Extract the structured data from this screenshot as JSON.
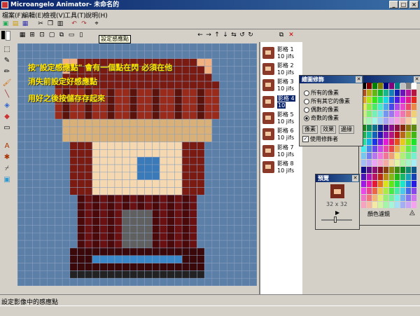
{
  "window": {
    "title": "Microangelo Animator- 未命名的"
  },
  "menu": [
    "檔案(F)",
    "編輯(E)",
    "檢視(V)",
    "工具(T)",
    "說明(H)"
  ],
  "tooltip": "設定感應點",
  "overlay": {
    "line1": "按\"設定感應點\"  會有一個點在閃  必須在他",
    "line2": "消失前設定好感應點",
    "line3": "用好之後按儲存存起來"
  },
  "frames": [
    {
      "label": "影格  1",
      "duration": "10 jifs"
    },
    {
      "label": "影格  2",
      "duration": "10 jifs"
    },
    {
      "label": "影格  3",
      "duration": "10 jifs"
    },
    {
      "label": "影格  4",
      "duration": "10"
    },
    {
      "label": "影格  5",
      "duration": "10 jifs"
    },
    {
      "label": "影格  6",
      "duration": "10 jifs"
    },
    {
      "label": "影格  7",
      "duration": "10 jifs"
    },
    {
      "label": "影格  8",
      "duration": "10 jifs"
    }
  ],
  "fill_panel": {
    "title": "繪圖修飾",
    "options": [
      "所有的像素",
      "所有其它的像素",
      "偶數的像素",
      "奇數的像素"
    ],
    "selected_option": "奇數的像素",
    "tabs": [
      "像素",
      "效果",
      "邊緣"
    ],
    "checkbox_label": "使用修飾者",
    "checkbox_checked": true
  },
  "palette": {
    "label": "顏色濾鏡"
  },
  "preview": {
    "title": "預覽",
    "size_text": "32 x 32"
  },
  "status": {
    "text": "設定影像中的感應點"
  },
  "colors": {
    "title_start": "#0a246a",
    "title_end": "#3a6ea5",
    "canvas_bg": "#5c7fa8",
    "overlay_text": "#ffe600"
  }
}
